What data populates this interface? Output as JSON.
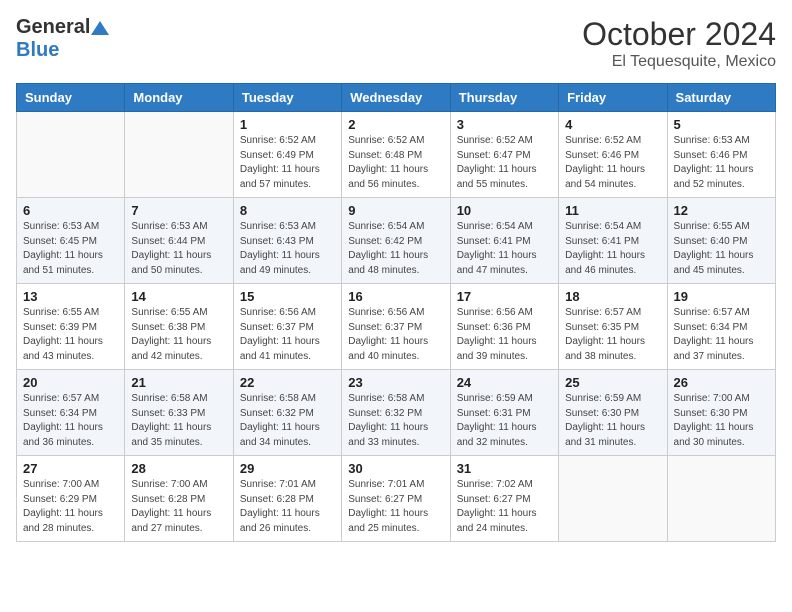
{
  "header": {
    "logo_general": "General",
    "logo_blue": "Blue",
    "month": "October 2024",
    "location": "El Tequesquite, Mexico"
  },
  "weekdays": [
    "Sunday",
    "Monday",
    "Tuesday",
    "Wednesday",
    "Thursday",
    "Friday",
    "Saturday"
  ],
  "weeks": [
    [
      {
        "day": "",
        "sunrise": "",
        "sunset": "",
        "daylight": ""
      },
      {
        "day": "",
        "sunrise": "",
        "sunset": "",
        "daylight": ""
      },
      {
        "day": "1",
        "sunrise": "Sunrise: 6:52 AM",
        "sunset": "Sunset: 6:49 PM",
        "daylight": "Daylight: 11 hours and 57 minutes."
      },
      {
        "day": "2",
        "sunrise": "Sunrise: 6:52 AM",
        "sunset": "Sunset: 6:48 PM",
        "daylight": "Daylight: 11 hours and 56 minutes."
      },
      {
        "day": "3",
        "sunrise": "Sunrise: 6:52 AM",
        "sunset": "Sunset: 6:47 PM",
        "daylight": "Daylight: 11 hours and 55 minutes."
      },
      {
        "day": "4",
        "sunrise": "Sunrise: 6:52 AM",
        "sunset": "Sunset: 6:46 PM",
        "daylight": "Daylight: 11 hours and 54 minutes."
      },
      {
        "day": "5",
        "sunrise": "Sunrise: 6:53 AM",
        "sunset": "Sunset: 6:46 PM",
        "daylight": "Daylight: 11 hours and 52 minutes."
      }
    ],
    [
      {
        "day": "6",
        "sunrise": "Sunrise: 6:53 AM",
        "sunset": "Sunset: 6:45 PM",
        "daylight": "Daylight: 11 hours and 51 minutes."
      },
      {
        "day": "7",
        "sunrise": "Sunrise: 6:53 AM",
        "sunset": "Sunset: 6:44 PM",
        "daylight": "Daylight: 11 hours and 50 minutes."
      },
      {
        "day": "8",
        "sunrise": "Sunrise: 6:53 AM",
        "sunset": "Sunset: 6:43 PM",
        "daylight": "Daylight: 11 hours and 49 minutes."
      },
      {
        "day": "9",
        "sunrise": "Sunrise: 6:54 AM",
        "sunset": "Sunset: 6:42 PM",
        "daylight": "Daylight: 11 hours and 48 minutes."
      },
      {
        "day": "10",
        "sunrise": "Sunrise: 6:54 AM",
        "sunset": "Sunset: 6:41 PM",
        "daylight": "Daylight: 11 hours and 47 minutes."
      },
      {
        "day": "11",
        "sunrise": "Sunrise: 6:54 AM",
        "sunset": "Sunset: 6:41 PM",
        "daylight": "Daylight: 11 hours and 46 minutes."
      },
      {
        "day": "12",
        "sunrise": "Sunrise: 6:55 AM",
        "sunset": "Sunset: 6:40 PM",
        "daylight": "Daylight: 11 hours and 45 minutes."
      }
    ],
    [
      {
        "day": "13",
        "sunrise": "Sunrise: 6:55 AM",
        "sunset": "Sunset: 6:39 PM",
        "daylight": "Daylight: 11 hours and 43 minutes."
      },
      {
        "day": "14",
        "sunrise": "Sunrise: 6:55 AM",
        "sunset": "Sunset: 6:38 PM",
        "daylight": "Daylight: 11 hours and 42 minutes."
      },
      {
        "day": "15",
        "sunrise": "Sunrise: 6:56 AM",
        "sunset": "Sunset: 6:37 PM",
        "daylight": "Daylight: 11 hours and 41 minutes."
      },
      {
        "day": "16",
        "sunrise": "Sunrise: 6:56 AM",
        "sunset": "Sunset: 6:37 PM",
        "daylight": "Daylight: 11 hours and 40 minutes."
      },
      {
        "day": "17",
        "sunrise": "Sunrise: 6:56 AM",
        "sunset": "Sunset: 6:36 PM",
        "daylight": "Daylight: 11 hours and 39 minutes."
      },
      {
        "day": "18",
        "sunrise": "Sunrise: 6:57 AM",
        "sunset": "Sunset: 6:35 PM",
        "daylight": "Daylight: 11 hours and 38 minutes."
      },
      {
        "day": "19",
        "sunrise": "Sunrise: 6:57 AM",
        "sunset": "Sunset: 6:34 PM",
        "daylight": "Daylight: 11 hours and 37 minutes."
      }
    ],
    [
      {
        "day": "20",
        "sunrise": "Sunrise: 6:57 AM",
        "sunset": "Sunset: 6:34 PM",
        "daylight": "Daylight: 11 hours and 36 minutes."
      },
      {
        "day": "21",
        "sunrise": "Sunrise: 6:58 AM",
        "sunset": "Sunset: 6:33 PM",
        "daylight": "Daylight: 11 hours and 35 minutes."
      },
      {
        "day": "22",
        "sunrise": "Sunrise: 6:58 AM",
        "sunset": "Sunset: 6:32 PM",
        "daylight": "Daylight: 11 hours and 34 minutes."
      },
      {
        "day": "23",
        "sunrise": "Sunrise: 6:58 AM",
        "sunset": "Sunset: 6:32 PM",
        "daylight": "Daylight: 11 hours and 33 minutes."
      },
      {
        "day": "24",
        "sunrise": "Sunrise: 6:59 AM",
        "sunset": "Sunset: 6:31 PM",
        "daylight": "Daylight: 11 hours and 32 minutes."
      },
      {
        "day": "25",
        "sunrise": "Sunrise: 6:59 AM",
        "sunset": "Sunset: 6:30 PM",
        "daylight": "Daylight: 11 hours and 31 minutes."
      },
      {
        "day": "26",
        "sunrise": "Sunrise: 7:00 AM",
        "sunset": "Sunset: 6:30 PM",
        "daylight": "Daylight: 11 hours and 30 minutes."
      }
    ],
    [
      {
        "day": "27",
        "sunrise": "Sunrise: 7:00 AM",
        "sunset": "Sunset: 6:29 PM",
        "daylight": "Daylight: 11 hours and 28 minutes."
      },
      {
        "day": "28",
        "sunrise": "Sunrise: 7:00 AM",
        "sunset": "Sunset: 6:28 PM",
        "daylight": "Daylight: 11 hours and 27 minutes."
      },
      {
        "day": "29",
        "sunrise": "Sunrise: 7:01 AM",
        "sunset": "Sunset: 6:28 PM",
        "daylight": "Daylight: 11 hours and 26 minutes."
      },
      {
        "day": "30",
        "sunrise": "Sunrise: 7:01 AM",
        "sunset": "Sunset: 6:27 PM",
        "daylight": "Daylight: 11 hours and 25 minutes."
      },
      {
        "day": "31",
        "sunrise": "Sunrise: 7:02 AM",
        "sunset": "Sunset: 6:27 PM",
        "daylight": "Daylight: 11 hours and 24 minutes."
      },
      {
        "day": "",
        "sunrise": "",
        "sunset": "",
        "daylight": ""
      },
      {
        "day": "",
        "sunrise": "",
        "sunset": "",
        "daylight": ""
      }
    ]
  ]
}
